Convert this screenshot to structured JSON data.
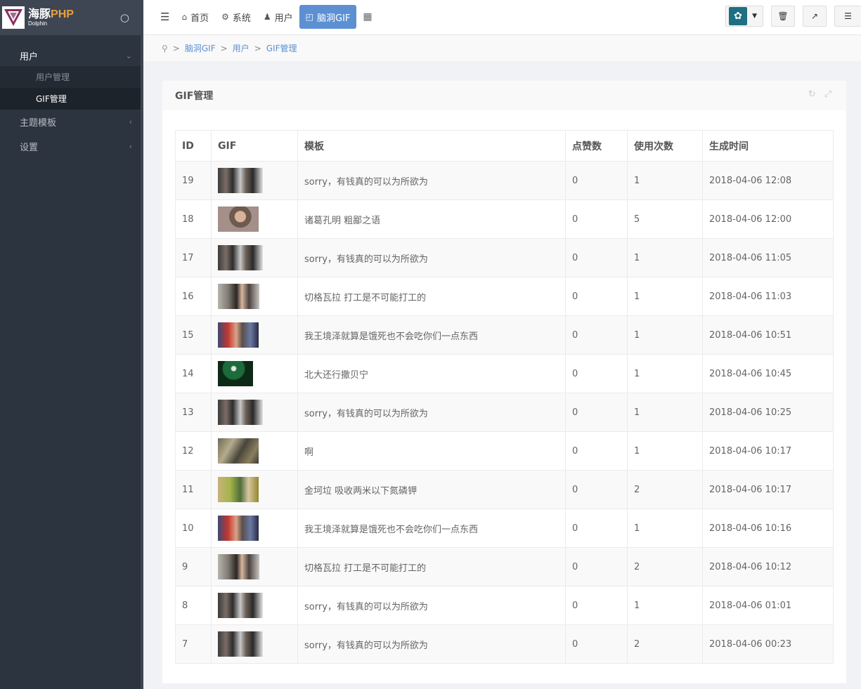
{
  "brand": {
    "name_cn": "海豚",
    "name_php": "PHP",
    "name_en": "Dolphin"
  },
  "sidebar": {
    "groups": [
      {
        "label": "用户",
        "open": true,
        "children": [
          {
            "label": "用户管理"
          },
          {
            "label": "GIF管理",
            "active": true
          }
        ]
      },
      {
        "label": "主题模板",
        "open": false
      },
      {
        "label": "设置",
        "open": false
      }
    ]
  },
  "topnav": {
    "items": [
      {
        "label": "首页",
        "icon": "home-icon"
      },
      {
        "label": "系统",
        "icon": "gear-icon"
      },
      {
        "label": "用户",
        "icon": "user-icon"
      },
      {
        "label": "脑洞GIF",
        "icon": "binoculars-icon",
        "active": true
      }
    ]
  },
  "breadcrumb": {
    "items": [
      "脑洞GIF",
      "用户",
      "GIF管理"
    ]
  },
  "block": {
    "title": "GIF管理"
  },
  "table": {
    "headers": [
      "ID",
      "GIF",
      "模板",
      "点赞数",
      "使用次数",
      "生成时间"
    ],
    "rows": [
      {
        "id": "19",
        "thumb": "a",
        "template": "sorry，有钱真的可以为所欲为",
        "likes": "0",
        "uses": "1",
        "time": "2018-04-06 12:08"
      },
      {
        "id": "18",
        "thumb": "b",
        "template": "诸葛孔明 粗鄙之语",
        "likes": "0",
        "uses": "5",
        "time": "2018-04-06 12:00"
      },
      {
        "id": "17",
        "thumb": "a",
        "template": "sorry，有钱真的可以为所欲为",
        "likes": "0",
        "uses": "1",
        "time": "2018-04-06 11:05"
      },
      {
        "id": "16",
        "thumb": "c",
        "template": "切格瓦拉 打工是不可能打工的",
        "likes": "0",
        "uses": "1",
        "time": "2018-04-06 11:03"
      },
      {
        "id": "15",
        "thumb": "d",
        "template": "我王境泽就算是饿死也不会吃你们一点东西",
        "likes": "0",
        "uses": "1",
        "time": "2018-04-06 10:51"
      },
      {
        "id": "14",
        "thumb": "e",
        "template": "北大还行撒贝宁",
        "likes": "0",
        "uses": "1",
        "time": "2018-04-06 10:45"
      },
      {
        "id": "13",
        "thumb": "a",
        "template": "sorry，有钱真的可以为所欲为",
        "likes": "0",
        "uses": "1",
        "time": "2018-04-06 10:25"
      },
      {
        "id": "12",
        "thumb": "f",
        "template": "啊",
        "likes": "0",
        "uses": "1",
        "time": "2018-04-06 10:17"
      },
      {
        "id": "11",
        "thumb": "g",
        "template": "金坷垃 吸收两米以下氮磷钾",
        "likes": "0",
        "uses": "2",
        "time": "2018-04-06 10:17"
      },
      {
        "id": "10",
        "thumb": "d",
        "template": "我王境泽就算是饿死也不会吃你们一点东西",
        "likes": "0",
        "uses": "1",
        "time": "2018-04-06 10:16"
      },
      {
        "id": "9",
        "thumb": "c",
        "template": "切格瓦拉 打工是不可能打工的",
        "likes": "0",
        "uses": "2",
        "time": "2018-04-06 10:12"
      },
      {
        "id": "8",
        "thumb": "a",
        "template": "sorry，有钱真的可以为所欲为",
        "likes": "0",
        "uses": "1",
        "time": "2018-04-06 01:01"
      },
      {
        "id": "7",
        "thumb": "a",
        "template": "sorry，有钱真的可以为所欲为",
        "likes": "0",
        "uses": "2",
        "time": "2018-04-06 00:23"
      }
    ]
  },
  "colors": {
    "sidebar": "#2c343f",
    "accent": "#5c90d2",
    "logo_php": "#e8a13a"
  }
}
